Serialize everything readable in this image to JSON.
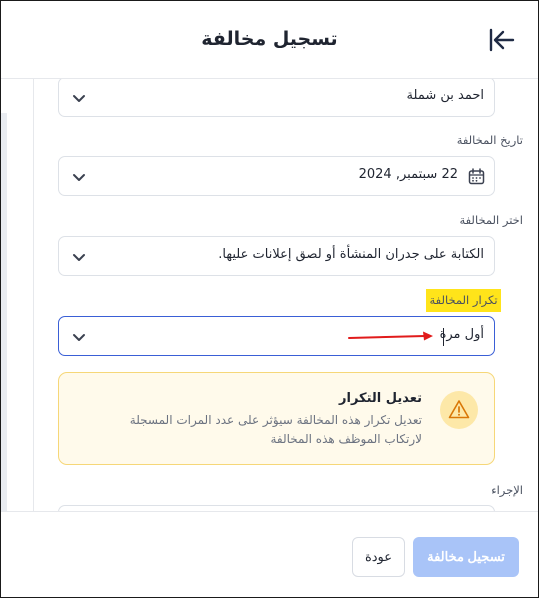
{
  "header": {
    "title": "تسجيل مخالفة"
  },
  "employee": {
    "value": "احمد بن شملة"
  },
  "violation_date": {
    "label": "تاريخ المخالفة",
    "value": "22 سبتمبر, 2024"
  },
  "violation": {
    "label": "اختر المخالفة",
    "value": "الكتابة على جدران المنشأة أو لصق إعلانات عليها."
  },
  "repetition": {
    "label": "تكرار المخالفة",
    "value": "أول مرة"
  },
  "warning": {
    "title": "تعديل التكرار",
    "description": "تعديل تكرار هذه المخالفة سيؤثر على عدد المرات المسجلة لارتكاب الموظف هذه المخالفة"
  },
  "action": {
    "label": "الإجراء"
  },
  "footer": {
    "submit_label": "تسجيل مخالفة",
    "back_label": "عودة"
  },
  "colors": {
    "accent": "#3a5fd6",
    "highlight": "#ffe41a",
    "arrow": "#e11b1b",
    "warning_bg": "#fffaeb",
    "warning_border": "#f6d778",
    "submit_disabled": "#a9c4f8"
  }
}
